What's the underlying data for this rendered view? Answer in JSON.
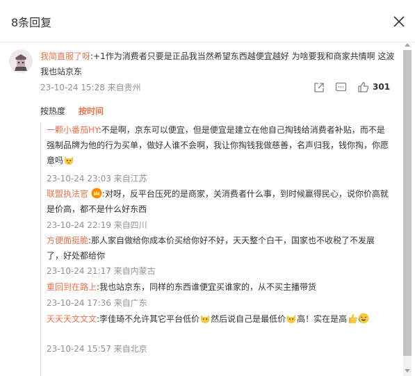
{
  "dialog": {
    "title": "8条回复",
    "close_icon": "close-icon"
  },
  "main_comment": {
    "user": "我简直服了呀",
    "text": ":+1作为消费者只要是正品我当然希望东西越便宜越好 为啥要我和商家共情啊 这波我也站京东",
    "time": "23-10-24 15:28 来自贵州",
    "like_count": "301",
    "icons": [
      "share-icon",
      "comment-icon",
      "like-icon"
    ]
  },
  "sort": {
    "hot": "按热度",
    "time": "按时间",
    "active": "time"
  },
  "replies": [
    {
      "user": "一颗小番茄HY",
      "text": ":不是啊，京东可以便宜，但是便宜是建立在他自己掏钱给消费者补贴，而不是强制品牌为他的行为买单，做好人谁不会啊，我让你掏钱我做慈善，名声归我，钱你掏，你愿意吗",
      "time": "23-10-24 23:03 来自江苏"
    },
    {
      "user": "联盟执法官",
      "text": ":对呀，反平台压死的是商家，关消费者什么事，到时候赢得民心，说你价高就是价高，都不是什么好东西",
      "time": "23-10-24 22:19 来自四川"
    },
    {
      "user": "方便面挺脆",
      "text": ":那人家自做给你成本价买给你好不好，天天整个白干，国家也不收税了不发展了，好处都给你",
      "time": "23-10-24 21:17 来自内蒙古"
    },
    {
      "user": "重回到在路上",
      "text": ":我也站京东，同样的东西谁便宜买谁家的，从不买主播带货",
      "time": "23-10-24 17:36 来自广东"
    },
    {
      "user": "天天天文文文",
      "text_a": ":李佳琦不允许其它平台低价",
      "text_b": "然后说自己是最低价",
      "text_c": "高！实在是高",
      "time": "23-10-24 15:57 来自北京"
    }
  ],
  "colors": {
    "username": "#eb7350",
    "meta": "#939393",
    "accent": "#ff8200"
  }
}
